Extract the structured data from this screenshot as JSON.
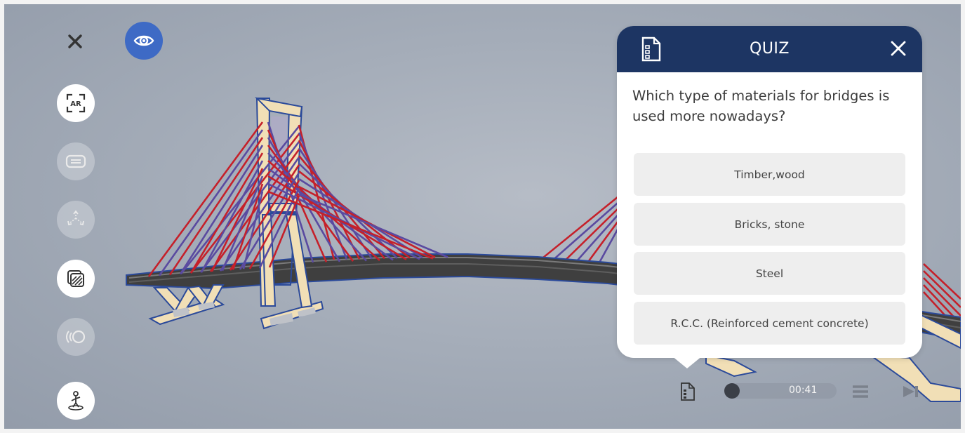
{
  "toolbar": {
    "left_buttons": [
      {
        "name": "close-icon",
        "state": "normal"
      },
      {
        "name": "ar-icon",
        "label": "AR",
        "state": "active"
      },
      {
        "name": "captions-icon",
        "state": "disabled"
      },
      {
        "name": "move-icon",
        "state": "disabled"
      },
      {
        "name": "layers-icon",
        "state": "active"
      },
      {
        "name": "sound-icon",
        "state": "disabled"
      },
      {
        "name": "person-pin-icon",
        "state": "active"
      }
    ],
    "visibility_button": {
      "icon": "eye-icon",
      "color": "#3e6ac5"
    }
  },
  "quiz": {
    "title": "QUIZ",
    "header_color": "#1d3563",
    "question": "Which type of materials for bridges is used more nowadays?",
    "answers": [
      "Timber,wood",
      "Bricks, stone",
      "Steel",
      "R.C.C. (Reinforced cement concrete)"
    ]
  },
  "player": {
    "time": "00:41",
    "progress": 0.0,
    "icons": [
      "quiz-doc-icon",
      "menu-icon",
      "skip-icon"
    ]
  },
  "colors": {
    "cable_red": "#c5202a",
    "cable_blue": "#5a4aa0",
    "tower": "#f1dfb6",
    "deck": "#4a4a4a"
  }
}
